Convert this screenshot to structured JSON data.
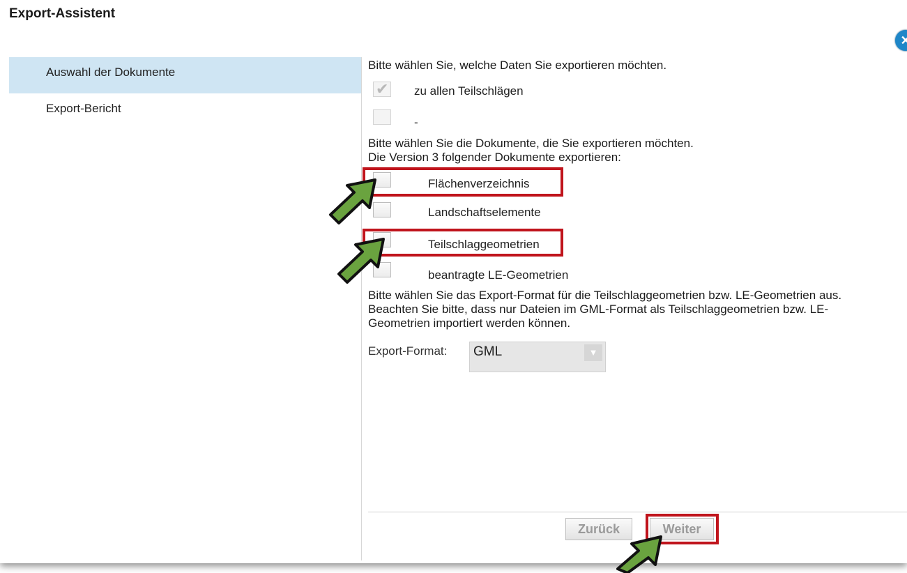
{
  "dialog": {
    "title": "Export-Assistent",
    "close_icon": "close-icon"
  },
  "nav": {
    "items": [
      {
        "label": "Auswahl der Dokumente",
        "active": true
      },
      {
        "label": "Export-Bericht",
        "active": false
      }
    ]
  },
  "content": {
    "intro": "Bitte wählen Sie, welche Daten Sie exportieren möchten.",
    "data_options": [
      {
        "label": "zu allen Teilschlägen",
        "checked": true,
        "disabled": true
      },
      {
        "label": "-",
        "checked": false,
        "disabled": true
      }
    ],
    "doc_intro_1": "Bitte wählen Sie die Dokumente, die Sie exportieren möchten.",
    "doc_intro_2": "Die Version 3 folgender Dokumente exportieren:",
    "documents": [
      {
        "label": "Flächenverzeichnis",
        "checked": false,
        "highlighted": true
      },
      {
        "label": "Landschaftselemente",
        "checked": false,
        "highlighted": false
      },
      {
        "label": "Teilschlaggeometrien",
        "checked": false,
        "highlighted": true
      },
      {
        "label": "beantragte LE-Geometrien",
        "checked": false,
        "highlighted": false
      }
    ],
    "format_text_1": "Bitte wählen Sie das Export-Format für die Teilschlaggeometrien bzw. LE-Geometrien aus.",
    "format_text_2": "Beachten Sie bitte, dass nur Dateien im GML-Format als Teilschlaggeometrien bzw. LE-",
    "format_text_3": "Geometrien importiert werden können.",
    "format_label": "Export-Format:",
    "format_value": "GML"
  },
  "buttons": {
    "back": "Zurück",
    "next": "Weiter"
  },
  "colors": {
    "highlight": "#c0141c",
    "annotation_arrow": "#6aa33f",
    "nav_active": "#cfe5f3",
    "close": "#1e86c8"
  }
}
